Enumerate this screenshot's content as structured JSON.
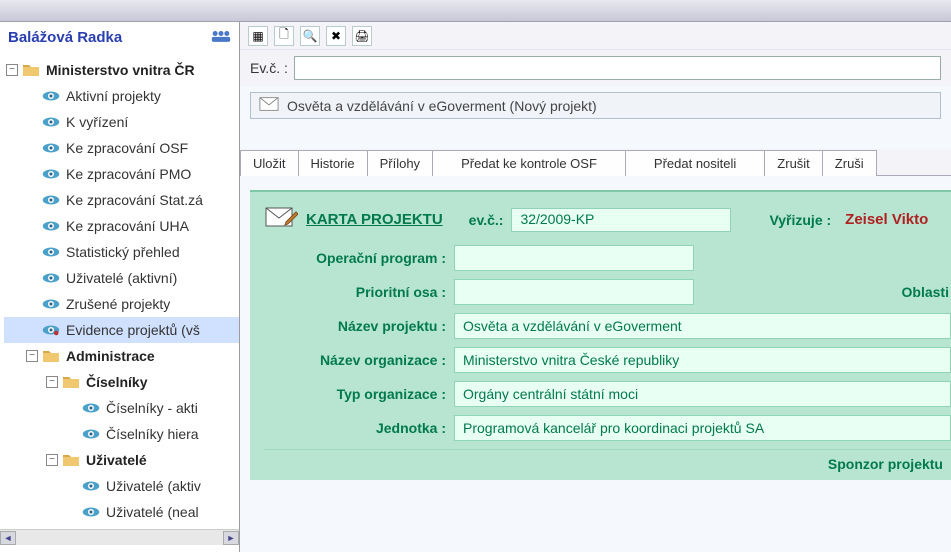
{
  "user": {
    "name": "Balážová Radka"
  },
  "tree": {
    "root": {
      "label": "Ministerstvo vnitra ČR"
    },
    "items": [
      {
        "label": "Aktivní projekty"
      },
      {
        "label": "K vyřízení"
      },
      {
        "label": "Ke zpracování OSF"
      },
      {
        "label": "Ke zpracování PMO"
      },
      {
        "label": "Ke zpracování Stat.zá"
      },
      {
        "label": "Ke zpracování UHA"
      },
      {
        "label": "Statistický přehled"
      },
      {
        "label": "Uživatelé (aktivní)"
      },
      {
        "label": "Zrušené projekty"
      },
      {
        "label": "Evidence projektů (vš"
      }
    ],
    "admin": {
      "label": "Administrace"
    },
    "ciselniky": {
      "label": "Číselníky",
      "children": [
        {
          "label": "Číselníky - akti"
        },
        {
          "label": "Číselníky hiera"
        }
      ]
    },
    "uzivatele": {
      "label": "Uživatelé",
      "children": [
        {
          "label": "Uživatelé (aktiv"
        },
        {
          "label": "Uživatelé (neal"
        }
      ]
    }
  },
  "header": {
    "evc_label": "Ev.č. :",
    "evc_value": "",
    "project_title": "Osvěta a vzdělávání v eGoverment (Nový projekt)"
  },
  "actions": {
    "save": "Uložit",
    "history": "Historie",
    "attachments": "Přílohy",
    "forward_osf": "Předat ke kontrole OSF",
    "forward_holder": "Předat nositeli",
    "cancel": "Zrušit",
    "cancel2": "Zruši"
  },
  "card": {
    "title": "KARTA PROJEKTU",
    "evc_label": "ev.č.:",
    "evc_value": "32/2009-KP",
    "vyrizuje_label": "Vyřizuje :",
    "vyrizuje_value": "Zeisel Vikto",
    "fields": {
      "operacni_program": {
        "label": "Operační program :",
        "value": ""
      },
      "prioritni_osa": {
        "label": "Prioritní osa :",
        "value": "",
        "oblast_label": "Oblasti"
      },
      "nazev_projektu": {
        "label": "Název projektu :",
        "value": "Osvěta a vzdělávání v eGoverment"
      },
      "nazev_organizace": {
        "label": "Název organizace :",
        "value": "Ministerstvo vnitra České republiky"
      },
      "typ_organizace": {
        "label": "Typ organizace :",
        "value": "Orgány centrální státní moci"
      },
      "jednotka": {
        "label": "Jednotka :",
        "value": "Programová kancelář pro koordinaci projektů SA"
      }
    },
    "sponsor_label": "Sponzor projektu"
  }
}
